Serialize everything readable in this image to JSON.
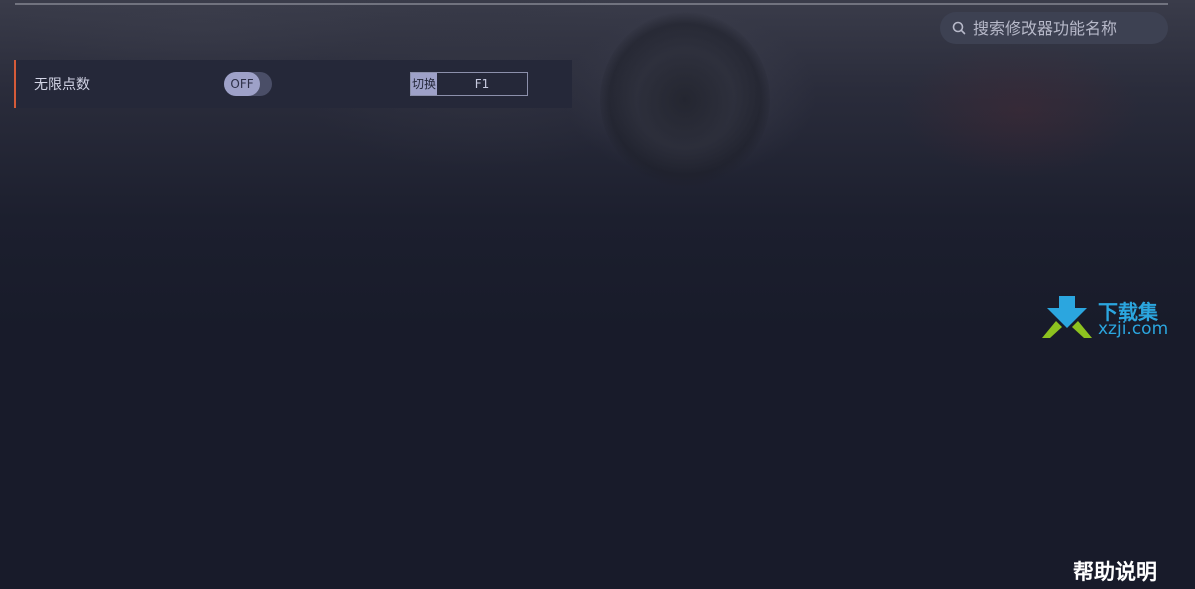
{
  "search": {
    "placeholder": "搜索修改器功能名称"
  },
  "cheats": [
    {
      "label": "无限点数",
      "toggle_state": "OFF",
      "hotkey_action": "切换",
      "hotkey_key": "F1"
    }
  ],
  "watermark": {
    "text_top": "下载集",
    "text_bottom": "xzji.com"
  },
  "footer": {
    "help_label": "帮助说明"
  },
  "colors": {
    "background": "#181b2a",
    "row_background": "#252839",
    "row_accent": "#d55b39",
    "toggle_knob": "#9ea1c8",
    "watermark_blue": "#2ba6df",
    "watermark_green": "#8dc21f"
  },
  "icons": {
    "search": "search-icon",
    "watermark_logo": "xzji-logo-icon"
  }
}
